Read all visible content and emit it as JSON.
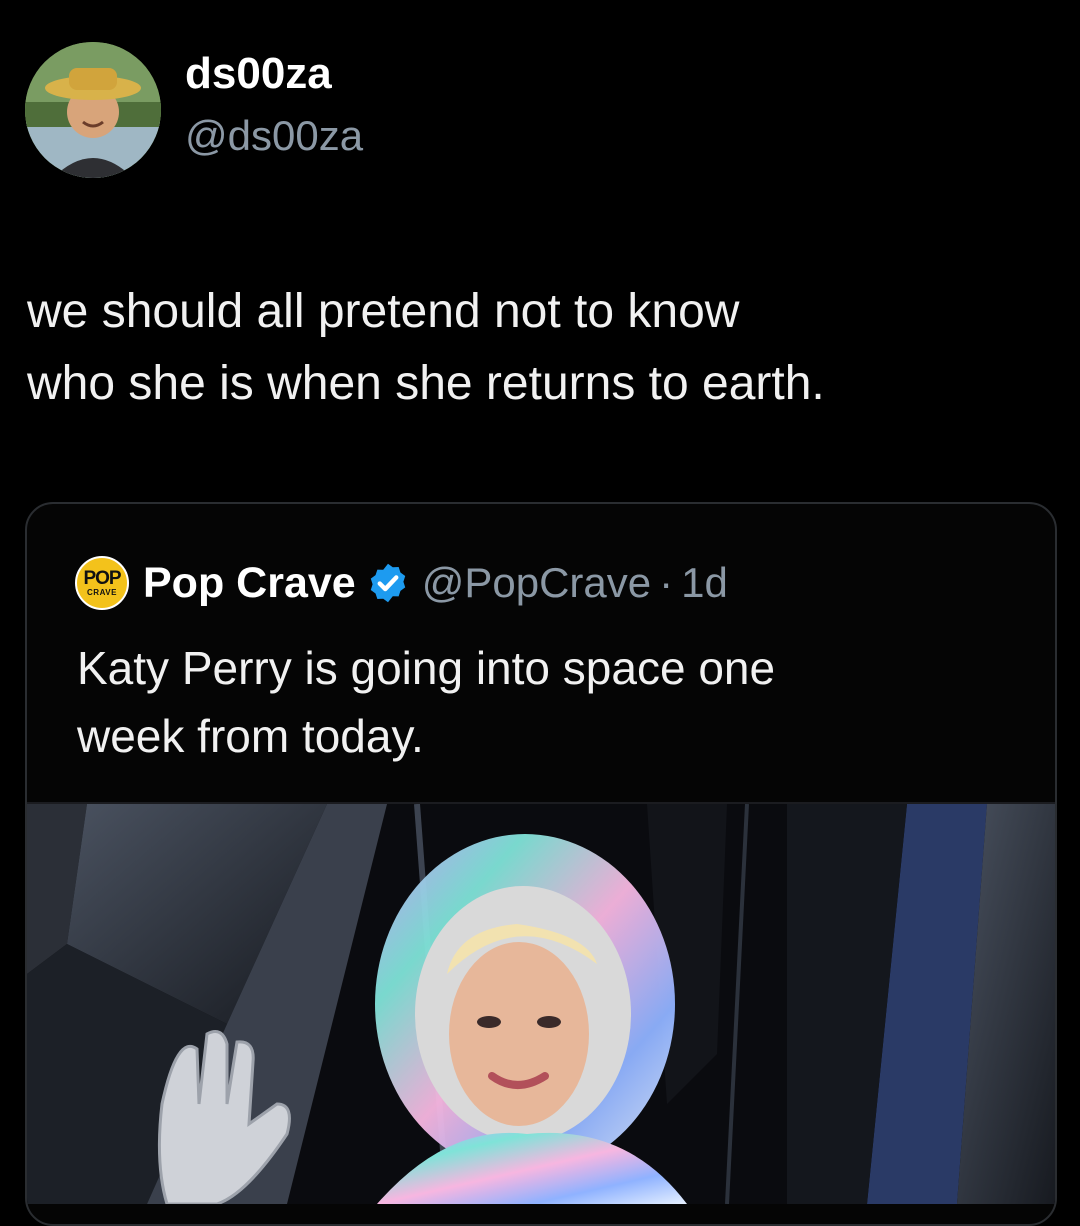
{
  "tweet": {
    "display_name": "ds00za",
    "handle": "@ds00za",
    "text": "we should all pretend not to know\nwho she is when she returns to earth."
  },
  "quoted": {
    "display_name": "Pop Crave",
    "handle": "@PopCrave",
    "separator": "·",
    "time": "1d",
    "text": "Katy Perry is going into space one\nweek from today.",
    "logo_top": "POP",
    "logo_bottom": "CRAVE"
  },
  "icons": {
    "verified": "verified-badge-icon",
    "avatar": "avatar"
  },
  "colors": {
    "background": "#000000",
    "verified": "#1d9bf0",
    "secondary_text": "#8b98a5"
  }
}
